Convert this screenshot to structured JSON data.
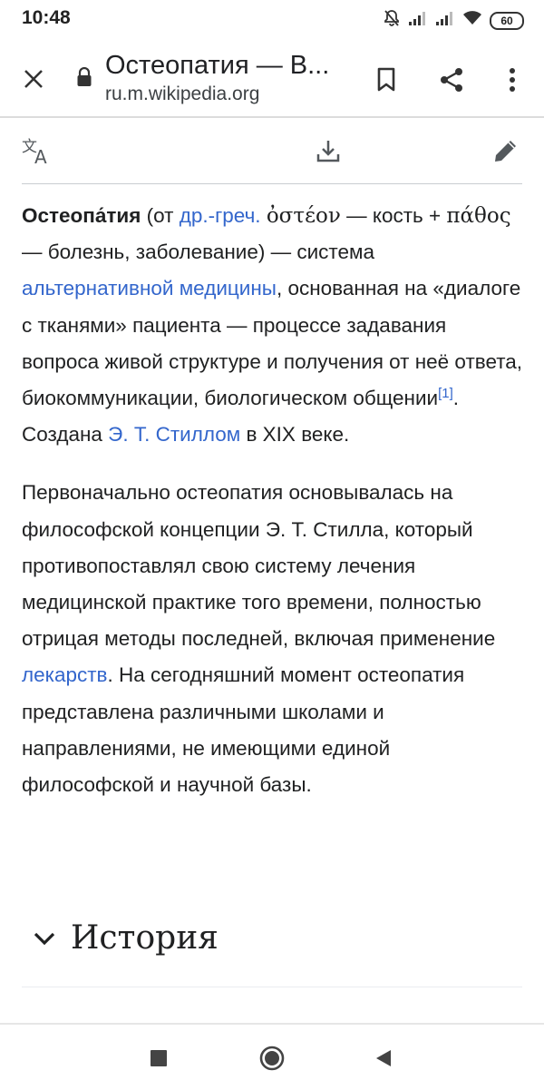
{
  "status_bar": {
    "time": "10:48",
    "battery": "60",
    "icons": [
      "mute-bell-icon",
      "signal-icon",
      "signal-icon",
      "wifi-icon",
      "battery-icon"
    ]
  },
  "browser": {
    "title": "Остеопатия — В...",
    "url": "ru.m.wikipedia.org",
    "icons": [
      "close-icon",
      "lock-icon",
      "bookmark-icon",
      "share-icon",
      "more-vert-icon"
    ]
  },
  "page_actions": {
    "icons": [
      "translate-icon",
      "download-icon",
      "edit-pencil-icon"
    ]
  },
  "article": {
    "p1": {
      "term": "Остеопа́тия",
      "t1": " (от ",
      "link_lang": "др.-греч.",
      "t2": " ",
      "greek1": "ὀστέον",
      "t3": " — кость + ",
      "greek2": "πάθος",
      "t4": " — болезнь, заболевание) — система ",
      "link_altmed": "альтернативной медицины",
      "t5": ", основанная на «диалоге с тканями» пациента — процессе задавания вопроса живой структуре и получения от неё ответа, биокоммуникации, биологическом общении",
      "ref": "[1]",
      "t6": ". Создана ",
      "link_still": "Э. Т. Стиллом",
      "t7": " в XIX веке."
    },
    "p2": {
      "t1": "Первоначально остеопатия основывалась на философской концепции Э. Т. Стилла, который противопоставлял свою систему лечения медицинской практике того времени, полностью отрицая методы последней, включая применение ",
      "link_drugs": "лекарств",
      "t2": ". На сегодняшний момент остеопатия представлена различными школами и направлениями, не имеющими единой философской и научной базы."
    }
  },
  "section": {
    "heading": "История",
    "icon": "chevron-down-icon"
  },
  "nav_bar": {
    "icons": [
      "recents-square-icon",
      "home-circle-icon",
      "back-triangle-icon"
    ]
  },
  "colors": {
    "link": "#3366cc",
    "text": "#202122",
    "divider": "#c8ccd1"
  }
}
